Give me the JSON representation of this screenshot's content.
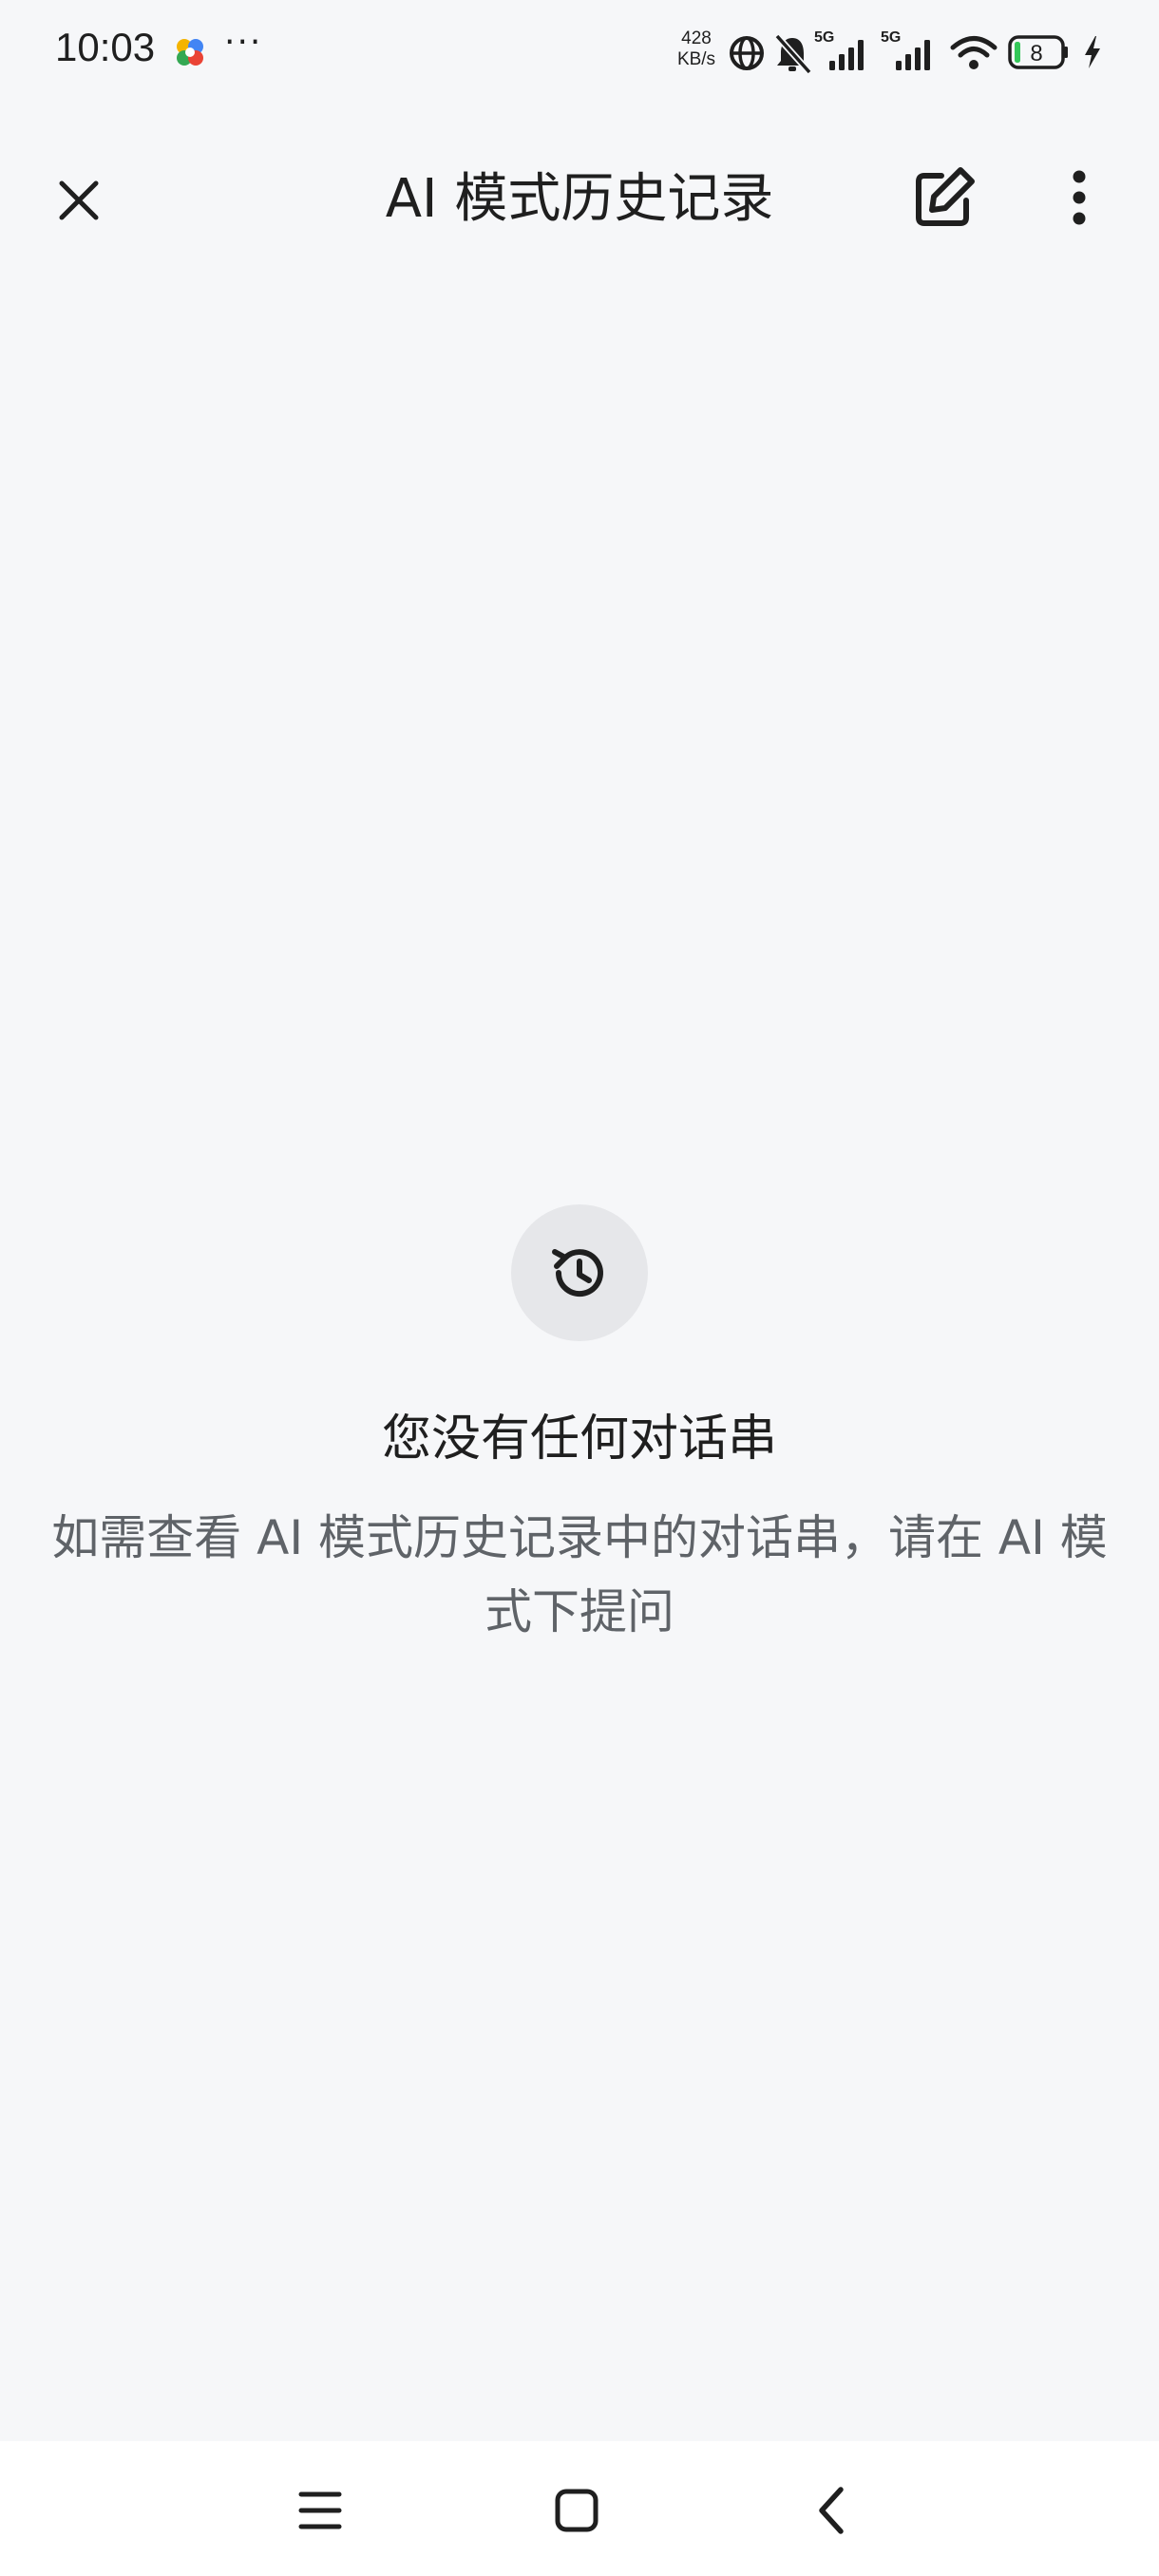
{
  "status_bar": {
    "time": "10:03",
    "more": "···",
    "net_speed_value": "428",
    "net_speed_unit": "KB/s",
    "signal_1_label": "5G",
    "signal_2_label": "5G",
    "battery_level": "8"
  },
  "app_bar": {
    "title": "AI 模式历史记录",
    "close_icon": "close-icon",
    "edit_icon": "edit-icon",
    "menu_icon": "more-vertical-icon"
  },
  "empty_state": {
    "icon": "history-icon",
    "heading": "您没有任何对话串",
    "description": "如需查看 AI 模式历史记录中的对话串，请在 AI 模式下提问"
  },
  "nav_bar": {
    "recents_icon": "menu-icon",
    "home_icon": "home-icon",
    "back_icon": "back-icon"
  },
  "colors": {
    "background": "#f6f7f9",
    "text_primary": "#1f1f1f",
    "text_secondary": "#5f6368",
    "icon_circle": "#e6e7ea",
    "battery_green": "#34c759"
  }
}
